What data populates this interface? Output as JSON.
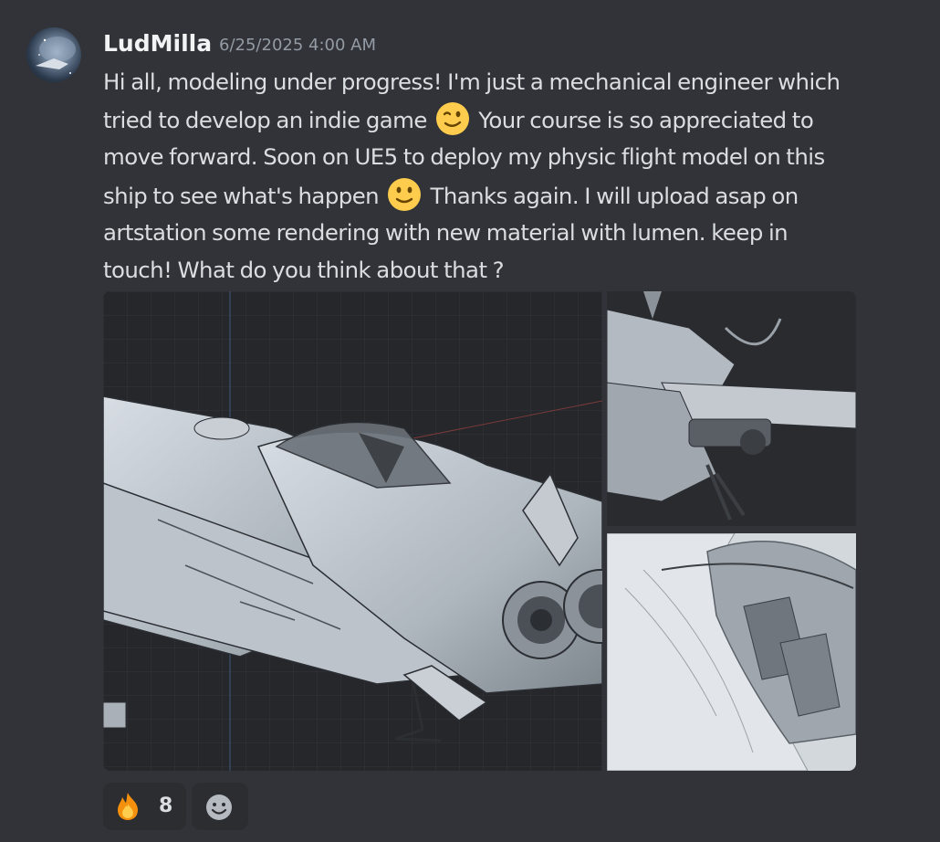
{
  "message": {
    "author": "LudMilla",
    "timestamp": "6/25/2025 4:00 AM",
    "avatar_icon": "space-scene-avatar",
    "text_lines": [
      {
        "segments": [
          {
            "text": "Hi all, modeling under progress! I'm just a mechanical engineer which"
          }
        ]
      },
      {
        "segments": [
          {
            "text": "tried to develop an indie game "
          },
          {
            "emoji": "winking-face-emoji"
          },
          {
            "text": " Your course is so appreciated to"
          }
        ]
      },
      {
        "segments": [
          {
            "text": "move forward. Soon on UE5 to deploy my physic flight model on this"
          }
        ]
      },
      {
        "segments": [
          {
            "text": "ship to see what's happen "
          },
          {
            "emoji": "slightly-smiling-face-emoji"
          },
          {
            "text": " Thanks again. I will upload asap on"
          }
        ]
      },
      {
        "segments": [
          {
            "text": "artstation some rendering with new material with lumen. keep in"
          }
        ]
      },
      {
        "segments": [
          {
            "text": "touch! What do you think about that ?"
          }
        ]
      }
    ],
    "attachments": [
      {
        "name": "attachment-main",
        "subject": "spaceship-3d-model-viewport"
      },
      {
        "name": "attachment-top-right",
        "subject": "landing-gear-closeup"
      },
      {
        "name": "attachment-bottom-right",
        "subject": "cockpit-closeup"
      }
    ],
    "reactions": [
      {
        "emoji": "fire-emoji",
        "count": "8"
      },
      {
        "emoji": "add-reaction-icon"
      }
    ]
  },
  "colors": {
    "background": "#313338",
    "username": "#f2f3f5",
    "timestamp": "#949ba4",
    "text": "#dbdee1",
    "reaction_bg": "#2b2d31"
  }
}
